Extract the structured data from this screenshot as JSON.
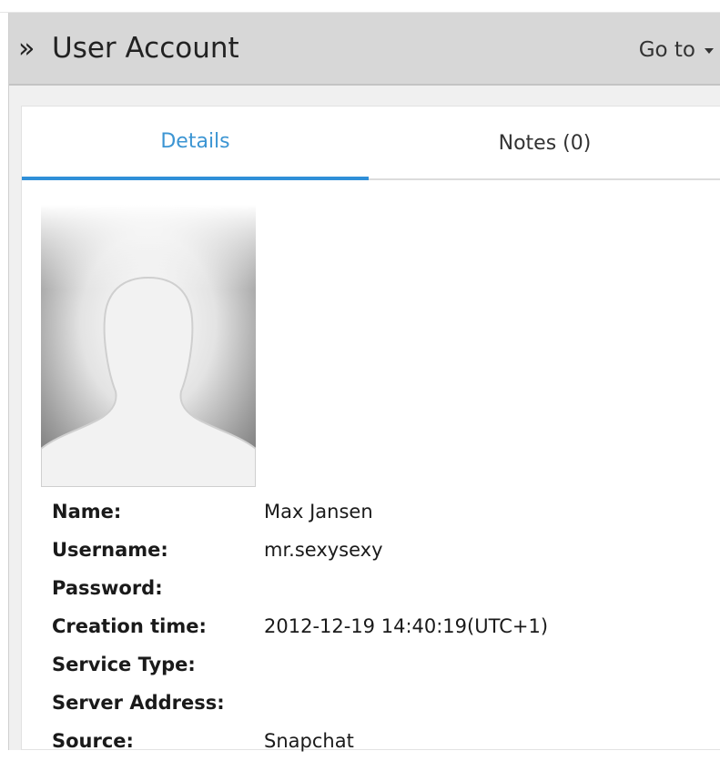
{
  "header": {
    "arrows": "»",
    "title": "User Account",
    "goto_label": "Go to"
  },
  "tabs": [
    {
      "label": "Details",
      "active": true
    },
    {
      "label": "Notes (0)",
      "active": false
    }
  ],
  "colors": {
    "accent": "#2f8fd8",
    "header_bg": "#d7d7d7",
    "frame_bg": "#f0f0f0"
  },
  "avatar": {
    "icon": "user-silhouette-icon"
  },
  "details": {
    "fields": [
      {
        "label": "Name:",
        "value": "Max Jansen"
      },
      {
        "label": "Username:",
        "value": "mr.sexysexy"
      },
      {
        "label": "Password:",
        "value": ""
      },
      {
        "label": "Creation time:",
        "value": "2012-12-19 14:40:19(UTC+1)"
      },
      {
        "label": "Service Type:",
        "value": ""
      },
      {
        "label": "Server Address:",
        "value": ""
      },
      {
        "label": "Source:",
        "value": "Snapchat"
      }
    ]
  }
}
